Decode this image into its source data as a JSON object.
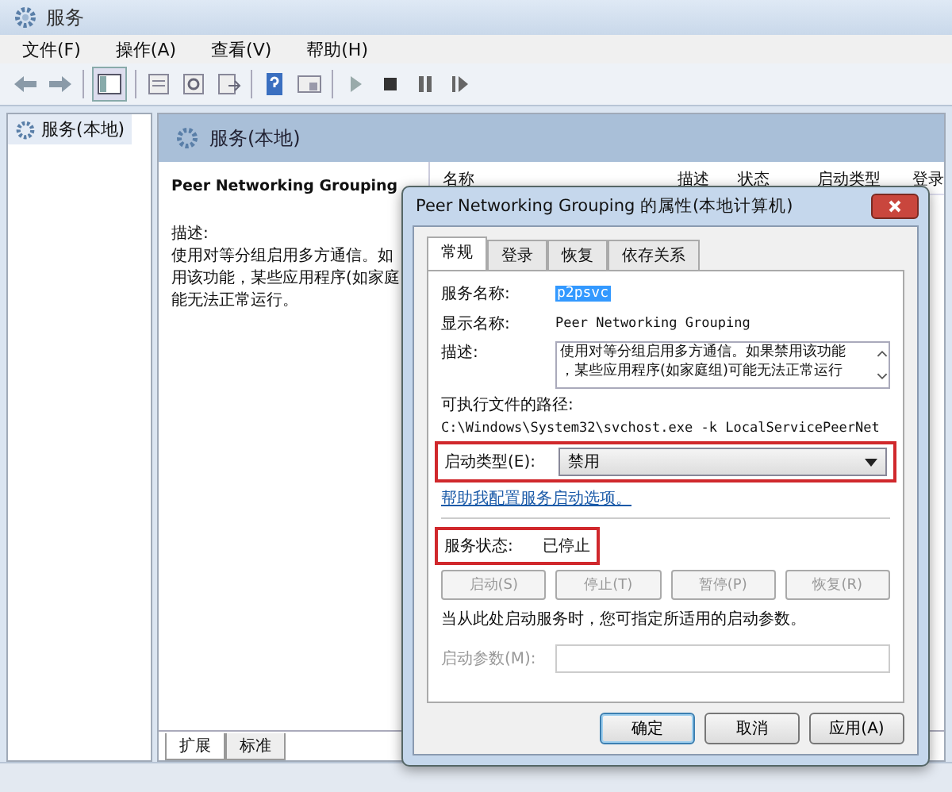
{
  "window": {
    "title": "服务"
  },
  "menu": [
    "文件(F)",
    "操作(A)",
    "查看(V)",
    "帮助(H)"
  ],
  "tree": [
    {
      "label": "服务(本地)",
      "selected": true
    }
  ],
  "pane": {
    "title": "服务(本地)",
    "service_name": "Peer Networking Grouping",
    "desc_label": "描述:",
    "desc_lines": [
      "使用对等分组启用多方通信。如",
      "用该功能，某些应用程序(如家庭",
      "能无法正常运行。"
    ]
  },
  "columns": [
    "名称",
    "描述",
    "状态",
    "启动类型",
    "登录"
  ],
  "view_tabs": [
    {
      "label": "扩展",
      "selected": true
    },
    {
      "label": "标准",
      "selected": false
    }
  ],
  "dialog": {
    "title": "Peer Networking Grouping 的属性(本地计算机)",
    "tabs": [
      {
        "label": "常规",
        "selected": true
      },
      {
        "label": "登录",
        "selected": false
      },
      {
        "label": "恢复",
        "selected": false
      },
      {
        "label": "依存关系",
        "selected": false
      }
    ],
    "service_name_label": "服务名称:",
    "service_name": "p2psvc",
    "display_name_label": "显示名称:",
    "display_name": "Peer Networking Grouping",
    "description_label": "描述:",
    "description_lines": [
      "使用对等分组启用多方通信。如果禁用该功能",
      "，某些应用程序(如家庭组)可能无法正常运行"
    ],
    "path_label": "可执行文件的路径:",
    "path": "C:\\Windows\\System32\\svchost.exe -k LocalServicePeerNet",
    "startup_label": "启动类型(E):",
    "startup_value": "禁用",
    "startup_highlighted": true,
    "help_link": "帮助我配置服务启动选项。",
    "status_label": "服务状态:",
    "status_value": "已停止",
    "status_highlighted": true,
    "service_buttons": [
      {
        "label": "启动(S)",
        "disabled": true
      },
      {
        "label": "停止(T)",
        "disabled": true
      },
      {
        "label": "暂停(P)",
        "disabled": true
      },
      {
        "label": "恢复(R)",
        "disabled": true
      }
    ],
    "hint": "当从此处启动服务时，您可指定所适用的启动参数。",
    "params_label": "启动参数(M):",
    "params_disabled": true,
    "buttons": [
      {
        "label": "确定",
        "default": true
      },
      {
        "label": "取消",
        "default": false
      },
      {
        "label": "应用(A)",
        "default": false
      }
    ]
  }
}
